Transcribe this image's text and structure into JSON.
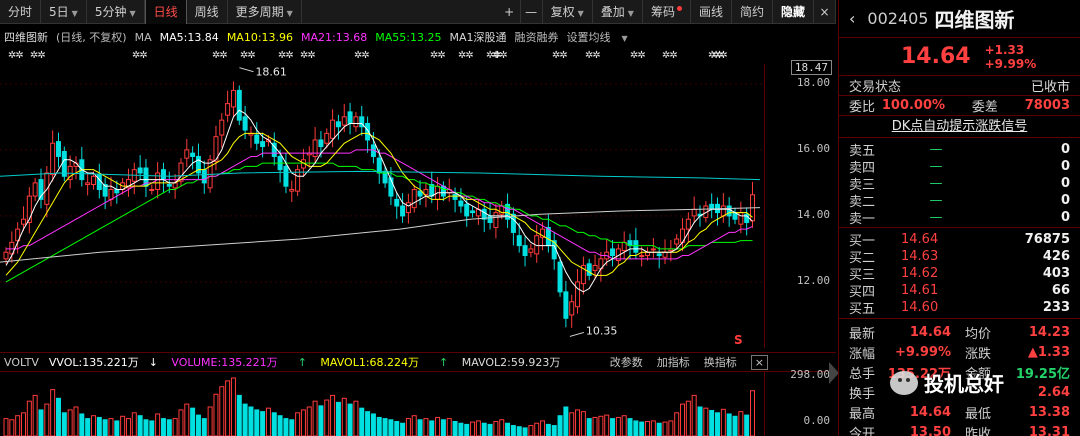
{
  "toolbar": {
    "periods": [
      "分时",
      "5日",
      "5分钟",
      "日线",
      "周线",
      "更多周期"
    ],
    "active_period": "日线",
    "tools": [
      "复权",
      "叠加",
      "筹码",
      "画线",
      "简约",
      "隐藏"
    ],
    "plus": "+",
    "minus": "—",
    "close": "×"
  },
  "legend": {
    "stock": "四维图新",
    "mode": "(日线, 不复权)",
    "ma": "MA",
    "ma5": "MA5:13.84",
    "ma10": "MA10:13.96",
    "ma21": "MA21:13.68",
    "ma55": "MA55:13.25",
    "ma1": "MA1深股通",
    "rzrq": "融资融券",
    "settings": "设置均线",
    "colors": {
      "ma5": "#ffffff",
      "ma10": "#ffff00",
      "ma21": "#ff33ff",
      "ma55": "#00ff00",
      "ma1": "#00cccc",
      "long": "#d0d0d0"
    }
  },
  "chart_data": {
    "type": "candlestick",
    "ylim": [
      10.0,
      18.6
    ],
    "y_ticks": [
      "18.47",
      "18.00",
      "16.00",
      "14.00",
      "12.00"
    ],
    "high_label": "18.61",
    "low_label": "10.35",
    "marker_s": "S",
    "closes": [
      12.9,
      13.2,
      13.6,
      13.9,
      14.6,
      15.0,
      14.5,
      15.3,
      16.2,
      15.8,
      15.2,
      15.5,
      15.6,
      15.1,
      15.0,
      15.2,
      14.8,
      14.6,
      14.8,
      14.7,
      15.0,
      15.1,
      15.4,
      15.3,
      14.9,
      14.8,
      15.3,
      15.1,
      14.9,
      15.0,
      15.6,
      16.0,
      15.8,
      15.3,
      15.0,
      15.7,
      16.4,
      16.9,
      17.4,
      17.8,
      16.9,
      16.6,
      16.5,
      16.2,
      16.1,
      16.3,
      15.8,
      15.4,
      14.9,
      14.8,
      15.4,
      15.7,
      15.9,
      16.3,
      16.1,
      16.5,
      16.9,
      16.7,
      17.0,
      16.8,
      17.0,
      16.7,
      16.3,
      15.8,
      15.3,
      15.0,
      14.6,
      14.3,
      14.0,
      14.4,
      14.8,
      14.6,
      14.8,
      14.6,
      14.9,
      14.6,
      14.8,
      14.5,
      14.3,
      14.0,
      14.1,
      14.2,
      13.9,
      13.8,
      14.1,
      14.3,
      13.9,
      13.5,
      13.1,
      12.8,
      13.0,
      13.4,
      13.6,
      13.1,
      12.7,
      11.7,
      10.9,
      11.4,
      12.0,
      12.5,
      12.2,
      12.5,
      12.7,
      12.9,
      12.8,
      13.0,
      13.2,
      13.1,
      12.9,
      12.8,
      12.9,
      13.0,
      12.8,
      12.9,
      13.0,
      13.3,
      13.6,
      13.9,
      14.2,
      14.0,
      14.3,
      14.2,
      14.1,
      14.3,
      14.0,
      13.9,
      14.1,
      13.8,
      14.64
    ],
    "ma5": [
      12.5,
      12.8,
      13.2,
      13.6,
      13.9,
      14.3,
      14.6,
      14.8,
      15.1,
      15.4,
      15.7,
      15.7,
      15.6,
      15.4,
      15.3,
      15.3,
      15.1,
      14.9,
      14.9,
      14.8,
      14.8,
      14.9,
      15.0,
      15.1,
      15.1,
      15.1,
      15.1,
      15.1,
      15.0,
      15.0,
      15.2,
      15.4,
      15.6,
      15.7,
      15.6,
      15.6,
      15.7,
      16.0,
      16.5,
      17.0,
      17.2,
      17.1,
      16.9,
      16.6,
      16.4,
      16.3,
      16.1,
      15.9,
      15.6,
      15.3,
      15.2,
      15.2,
      15.4,
      15.6,
      15.9,
      16.1,
      16.3,
      16.5,
      16.7,
      16.8,
      16.8,
      16.8,
      16.6,
      16.3,
      15.9,
      15.5,
      15.1,
      14.7,
      14.4,
      14.3,
      14.4,
      14.5,
      14.6,
      14.6,
      14.7,
      14.7,
      14.7,
      14.7,
      14.6,
      14.4,
      14.3,
      14.2,
      14.1,
      14.0,
      14.0,
      14.0,
      14.0,
      13.9,
      13.7,
      13.4,
      13.2,
      13.1,
      13.1,
      13.1,
      13.1,
      12.7,
      12.3,
      12.0,
      11.8,
      11.7,
      11.8,
      12.1,
      12.4,
      12.6,
      12.7,
      12.8,
      12.9,
      13.0,
      13.0,
      13.0,
      12.9,
      12.9,
      12.9,
      12.9,
      12.9,
      13.0,
      13.2,
      13.5,
      13.8,
      14.0,
      14.1,
      14.2,
      14.2,
      14.2,
      14.2,
      14.1,
      14.0,
      14.0,
      13.84
    ],
    "ma10": [
      12.2,
      12.4,
      12.6,
      12.9,
      13.2,
      13.5,
      13.8,
      14.1,
      14.4,
      14.7,
      15.0,
      15.2,
      15.3,
      15.4,
      15.4,
      15.4,
      15.3,
      15.2,
      15.1,
      15.0,
      14.9,
      14.9,
      14.9,
      14.9,
      14.9,
      15.0,
      15.0,
      15.0,
      15.0,
      15.0,
      15.1,
      15.2,
      15.3,
      15.4,
      15.4,
      15.5,
      15.6,
      15.7,
      15.9,
      16.2,
      16.4,
      16.5,
      16.5,
      16.5,
      16.5,
      16.4,
      16.3,
      16.2,
      16.0,
      15.8,
      15.7,
      15.6,
      15.5,
      15.5,
      15.5,
      15.6,
      15.8,
      16.0,
      16.2,
      16.3,
      16.4,
      16.5,
      16.5,
      16.4,
      16.3,
      16.1,
      15.9,
      15.6,
      15.3,
      15.1,
      14.9,
      14.8,
      14.6,
      14.5,
      14.5,
      14.5,
      14.6,
      14.6,
      14.6,
      14.5,
      14.5,
      14.4,
      14.3,
      14.2,
      14.2,
      14.1,
      14.1,
      14.0,
      13.9,
      13.8,
      13.6,
      13.5,
      13.4,
      13.3,
      13.2,
      13.0,
      12.8,
      12.6,
      12.5,
      12.4,
      12.3,
      12.2,
      12.2,
      12.2,
      12.3,
      12.5,
      12.6,
      12.8,
      12.8,
      12.9,
      12.9,
      12.9,
      12.9,
      12.9,
      12.9,
      12.9,
      13.0,
      13.2,
      13.3,
      13.5,
      13.6,
      13.8,
      13.9,
      14.0,
      14.1,
      14.1,
      14.1,
      14.1,
      13.96
    ],
    "ma21": [
      13.0,
      13.0,
      13.0,
      13.1,
      13.1,
      13.2,
      13.3,
      13.4,
      13.5,
      13.6,
      13.7,
      13.8,
      13.9,
      14.0,
      14.1,
      14.2,
      14.3,
      14.4,
      14.5,
      14.6,
      14.7,
      14.8,
      14.9,
      14.9,
      15.0,
      15.0,
      15.1,
      15.1,
      15.1,
      15.1,
      15.1,
      15.1,
      15.1,
      15.1,
      15.1,
      15.2,
      15.2,
      15.3,
      15.4,
      15.5,
      15.6,
      15.7,
      15.8,
      15.8,
      15.9,
      15.9,
      15.9,
      15.9,
      15.9,
      15.9,
      15.9,
      15.9,
      15.9,
      15.9,
      15.9,
      15.9,
      15.9,
      15.9,
      15.9,
      15.9,
      16.0,
      16.0,
      16.0,
      16.0,
      15.9,
      15.9,
      15.8,
      15.7,
      15.6,
      15.5,
      15.4,
      15.3,
      15.2,
      15.1,
      15.0,
      14.9,
      14.8,
      14.7,
      14.6,
      14.6,
      14.5,
      14.5,
      14.4,
      14.4,
      14.3,
      14.3,
      14.2,
      14.2,
      14.1,
      14.0,
      13.9,
      13.8,
      13.7,
      13.6,
      13.5,
      13.4,
      13.3,
      13.2,
      13.1,
      13.0,
      12.9,
      12.9,
      12.8,
      12.8,
      12.7,
      12.7,
      12.7,
      12.7,
      12.7,
      12.7,
      12.7,
      12.7,
      12.7,
      12.7,
      12.7,
      12.7,
      12.8,
      12.8,
      12.9,
      13.0,
      13.1,
      13.2,
      13.3,
      13.4,
      13.5,
      13.5,
      13.6,
      13.6,
      13.68
    ],
    "ma55": [
      12.0,
      12.1,
      12.2,
      12.3,
      12.4,
      12.5,
      12.6,
      12.7,
      12.8,
      12.9,
      13.0,
      13.1,
      13.2,
      13.3,
      13.4,
      13.5,
      13.6,
      13.7,
      13.8,
      13.9,
      14.0,
      14.1,
      14.2,
      14.3,
      14.4,
      14.5,
      14.6,
      14.7,
      14.8,
      14.8,
      14.9,
      15.0,
      15.0,
      15.1,
      15.1,
      15.2,
      15.2,
      15.3,
      15.3,
      15.4,
      15.4,
      15.5,
      15.5,
      15.5,
      15.6,
      15.6,
      15.6,
      15.6,
      15.6,
      15.6,
      15.6,
      15.6,
      15.6,
      15.6,
      15.6,
      15.6,
      15.6,
      15.5,
      15.5,
      15.5,
      15.5,
      15.4,
      15.4,
      15.4,
      15.3,
      15.3,
      15.3,
      15.2,
      15.2,
      15.1,
      15.1,
      15.0,
      15.0,
      14.9,
      14.9,
      14.8,
      14.8,
      14.7,
      14.7,
      14.6,
      14.6,
      14.5,
      14.5,
      14.4,
      14.4,
      14.3,
      14.3,
      14.2,
      14.2,
      14.1,
      14.0,
      14.0,
      13.9,
      13.9,
      13.8,
      13.7,
      13.7,
      13.6,
      13.5,
      13.5,
      13.4,
      13.4,
      13.3,
      13.3,
      13.2,
      13.2,
      13.2,
      13.1,
      13.1,
      13.1,
      13.1,
      13.1,
      13.0,
      13.0,
      13.0,
      13.0,
      13.0,
      13.1,
      13.1,
      13.1,
      13.1,
      13.2,
      13.2,
      13.2,
      13.2,
      13.2,
      13.25,
      13.25,
      13.25
    ],
    "ma1_line": [
      [
        0,
        15.2
      ],
      [
        60,
        15.3
      ],
      [
        170,
        15.2
      ],
      [
        240,
        15.3
      ],
      [
        360,
        15.35
      ],
      [
        480,
        15.3
      ],
      [
        600,
        15.2
      ],
      [
        700,
        15.15
      ],
      [
        760,
        15.1
      ]
    ],
    "long_line": [
      [
        0,
        12.6
      ],
      [
        100,
        12.9
      ],
      [
        200,
        13.1
      ],
      [
        300,
        13.3
      ],
      [
        400,
        13.6
      ],
      [
        470,
        13.9
      ],
      [
        540,
        14.05
      ],
      [
        620,
        14.15
      ],
      [
        700,
        14.2
      ],
      [
        760,
        14.25
      ]
    ]
  },
  "star_positions": [
    8,
    30,
    132,
    212,
    240,
    278,
    300,
    354,
    430,
    458,
    486,
    492,
    552,
    585,
    630,
    662,
    708,
    712
  ],
  "volume": {
    "vol_label": "VOLTV",
    "vvol": "VVOL:135.221万",
    "volume": "VOLUME:135.221万",
    "mavol1": "MAVOL1:68.224万",
    "mavol2": "MAVOL2:59.923万",
    "buttons": [
      "改参数",
      "加指标",
      "换指标"
    ],
    "close": "×",
    "ticks": [
      "298.00",
      "0.00"
    ],
    "values": [
      30,
      28,
      35,
      40,
      60,
      70,
      45,
      55,
      80,
      65,
      40,
      45,
      50,
      38,
      30,
      35,
      32,
      28,
      30,
      26,
      34,
      30,
      40,
      35,
      28,
      26,
      38,
      30,
      28,
      30,
      45,
      55,
      48,
      36,
      30,
      50,
      72,
      85,
      95,
      100,
      70,
      55,
      50,
      45,
      42,
      48,
      40,
      35,
      30,
      28,
      40,
      45,
      50,
      60,
      52,
      62,
      70,
      58,
      65,
      55,
      60,
      48,
      42,
      38,
      32,
      30,
      28,
      25,
      22,
      30,
      35,
      28,
      30,
      26,
      32,
      28,
      30,
      25,
      22,
      20,
      24,
      26,
      22,
      20,
      25,
      28,
      22,
      18,
      16,
      14,
      18,
      22,
      26,
      20,
      18,
      35,
      50,
      40,
      45,
      42,
      30,
      32,
      34,
      36,
      30,
      32,
      35,
      30,
      26,
      24,
      25,
      26,
      22,
      24,
      26,
      40,
      55,
      60,
      70,
      50,
      48,
      44,
      40,
      46,
      38,
      34,
      42,
      36,
      78
    ]
  },
  "panel": {
    "code": "002405",
    "name": "四维图新",
    "price": "14.64",
    "chg": "+1.33",
    "chg_pct": "+9.99%",
    "status_lbl": "交易状态",
    "status_val": "已收市",
    "wb_lbl": "委比",
    "wb_val": "100.00%",
    "wc_lbl": "委差",
    "wc_val": "78003",
    "dk": "DK点自动提示涨跌信号",
    "asks": [
      {
        "l": "卖五",
        "p": "—",
        "v": "0"
      },
      {
        "l": "卖四",
        "p": "—",
        "v": "0"
      },
      {
        "l": "卖三",
        "p": "—",
        "v": "0"
      },
      {
        "l": "卖二",
        "p": "—",
        "v": "0"
      },
      {
        "l": "卖一",
        "p": "—",
        "v": "0"
      }
    ],
    "bids": [
      {
        "l": "买一",
        "p": "14.64",
        "v": "76875"
      },
      {
        "l": "买二",
        "p": "14.63",
        "v": "426"
      },
      {
        "l": "买三",
        "p": "14.62",
        "v": "403"
      },
      {
        "l": "买四",
        "p": "14.61",
        "v": "66"
      },
      {
        "l": "买五",
        "p": "14.60",
        "v": "233"
      }
    ],
    "quotes": [
      {
        "l1": "最新",
        "v1": "14.64",
        "l2": "均价",
        "v2": "14.23"
      },
      {
        "l1": "涨幅",
        "v1": "+9.99%",
        "l2": "涨跌",
        "v2": "▲1.33"
      },
      {
        "l1": "总手",
        "v1": "135.22万",
        "l2": "金额",
        "v2": "19.25亿"
      },
      {
        "l1": "换手",
        "v1": "",
        "l2": "",
        "v2": "2.64"
      },
      {
        "l1": "最高",
        "v1": "14.64",
        "l2": "最低",
        "v2": "13.38"
      },
      {
        "l1": "今开",
        "v1": "13.50",
        "l2": "昨收",
        "v2": "13.31"
      }
    ],
    "watermark": "投机总奸"
  }
}
